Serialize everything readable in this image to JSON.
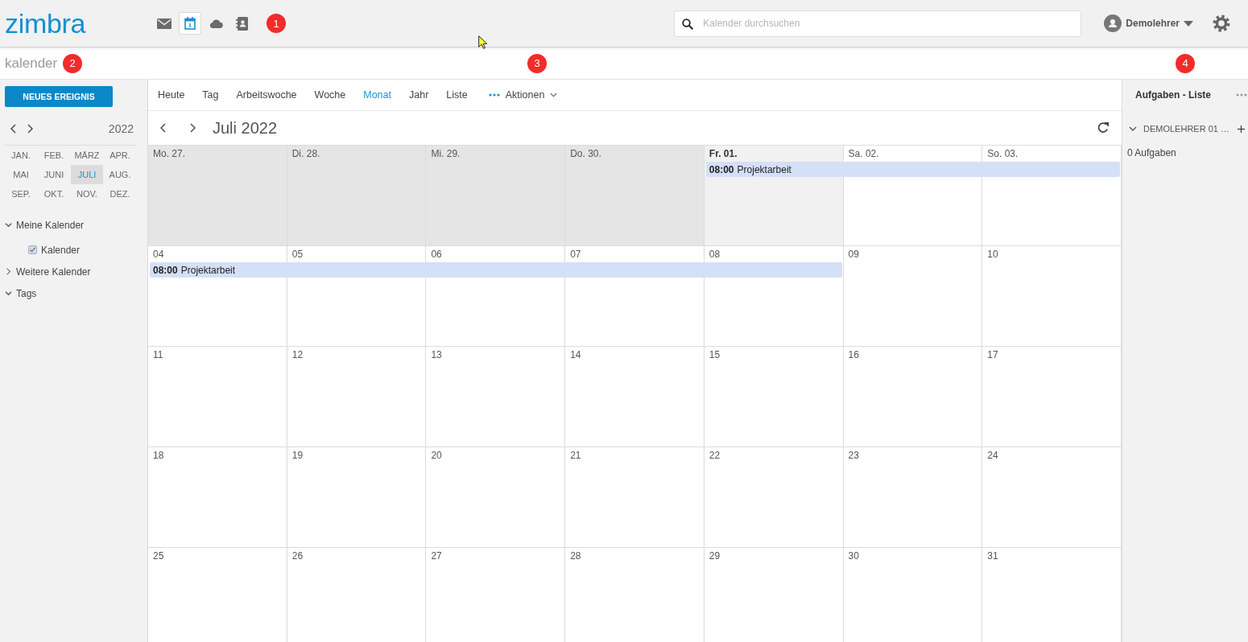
{
  "header": {
    "logo": "zimbra",
    "apps": [
      {
        "kind": "mail",
        "selected": false
      },
      {
        "kind": "calendar",
        "selected": true
      },
      {
        "kind": "cloud",
        "selected": false
      },
      {
        "kind": "contacts",
        "selected": false
      }
    ],
    "marker": "1",
    "search": {
      "placeholder": "Kalender durchsuchen"
    },
    "user": {
      "name": "Demolehrer"
    }
  },
  "page_title": {
    "text": "kalender",
    "marker": "2"
  },
  "sidebar": {
    "new_button": "NEUES EREIGNIS",
    "mini_calendar": {
      "year": "2022",
      "months": [
        {
          "label": "JAN.",
          "selected": false
        },
        {
          "label": "FEB.",
          "selected": false
        },
        {
          "label": "MÄRZ",
          "selected": false
        },
        {
          "label": "APR.",
          "selected": false
        },
        {
          "label": "MAI",
          "selected": false
        },
        {
          "label": "JUNI",
          "selected": false
        },
        {
          "label": "JULI",
          "selected": true
        },
        {
          "label": "AUG.",
          "selected": false
        },
        {
          "label": "SEP.",
          "selected": false
        },
        {
          "label": "OKT.",
          "selected": false
        },
        {
          "label": "NOV.",
          "selected": false
        },
        {
          "label": "DEZ.",
          "selected": false
        }
      ]
    },
    "folders": [
      {
        "label": "Meine Kalender",
        "expanded": true,
        "children": [
          {
            "label": "Kalender",
            "checked": true
          }
        ]
      },
      {
        "label": "Weitere Kalender",
        "expanded": false
      },
      {
        "label": "Tags",
        "expanded": true
      }
    ]
  },
  "calendar": {
    "marker": "3",
    "views": [
      {
        "label": "Heute",
        "selected": false
      },
      {
        "label": "Tag",
        "selected": false
      },
      {
        "label": "Arbeitswoche",
        "selected": false
      },
      {
        "label": "Woche",
        "selected": false
      },
      {
        "label": "Monat",
        "selected": true
      },
      {
        "label": "Jahr",
        "selected": false
      },
      {
        "label": "Liste",
        "selected": false
      }
    ],
    "actions": "Aktionen",
    "title": "Juli 2022",
    "weeks": [
      {
        "days": [
          {
            "label": "Mo. 27.",
            "kind": "outside",
            "in_event": false
          },
          {
            "label": "Di. 28.",
            "kind": "outside",
            "in_event": false
          },
          {
            "label": "Mi. 29.",
            "kind": "outside",
            "in_event": false
          },
          {
            "label": "Do. 30.",
            "kind": "outside",
            "in_event": false
          },
          {
            "label": "Fr. 01.",
            "kind": "today",
            "in_event": true
          },
          {
            "label": "Sa. 02.",
            "kind": "normal",
            "in_event": true
          },
          {
            "label": "So. 03.",
            "kind": "normal",
            "in_event": true
          }
        ],
        "event": {
          "time": "08:00",
          "title": "Projektarbeit"
        }
      },
      {
        "days": [
          {
            "label": "04",
            "kind": "normal",
            "in_event": true
          },
          {
            "label": "05",
            "kind": "normal",
            "in_event": true
          },
          {
            "label": "06",
            "kind": "normal",
            "in_event": true
          },
          {
            "label": "07",
            "kind": "normal",
            "in_event": true
          },
          {
            "label": "08",
            "kind": "normal",
            "in_event": true
          },
          {
            "label": "09",
            "kind": "normal",
            "in_event": false
          },
          {
            "label": "10",
            "kind": "normal",
            "in_event": false
          }
        ],
        "event": {
          "time": "08:00",
          "title": "Projektarbeit"
        }
      },
      {
        "days": [
          {
            "label": "11",
            "kind": "normal"
          },
          {
            "label": "12",
            "kind": "normal"
          },
          {
            "label": "13",
            "kind": "normal"
          },
          {
            "label": "14",
            "kind": "normal"
          },
          {
            "label": "15",
            "kind": "normal"
          },
          {
            "label": "16",
            "kind": "normal"
          },
          {
            "label": "17",
            "kind": "normal"
          }
        ]
      },
      {
        "days": [
          {
            "label": "18",
            "kind": "normal"
          },
          {
            "label": "19",
            "kind": "normal"
          },
          {
            "label": "20",
            "kind": "normal"
          },
          {
            "label": "21",
            "kind": "normal"
          },
          {
            "label": "22",
            "kind": "normal"
          },
          {
            "label": "23",
            "kind": "normal"
          },
          {
            "label": "24",
            "kind": "normal"
          }
        ]
      },
      {
        "days": [
          {
            "label": "25",
            "kind": "normal"
          },
          {
            "label": "26",
            "kind": "normal"
          },
          {
            "label": "27",
            "kind": "normal"
          },
          {
            "label": "28",
            "kind": "normal"
          },
          {
            "label": "29",
            "kind": "normal"
          },
          {
            "label": "30",
            "kind": "normal"
          },
          {
            "label": "31",
            "kind": "normal"
          }
        ]
      }
    ]
  },
  "tasks": {
    "marker": "4",
    "title": "Aufgaben - Liste",
    "folder": {
      "label": "DEMOLEHRER 01 …",
      "expanded": true
    },
    "count": "0 Aufgaben"
  }
}
